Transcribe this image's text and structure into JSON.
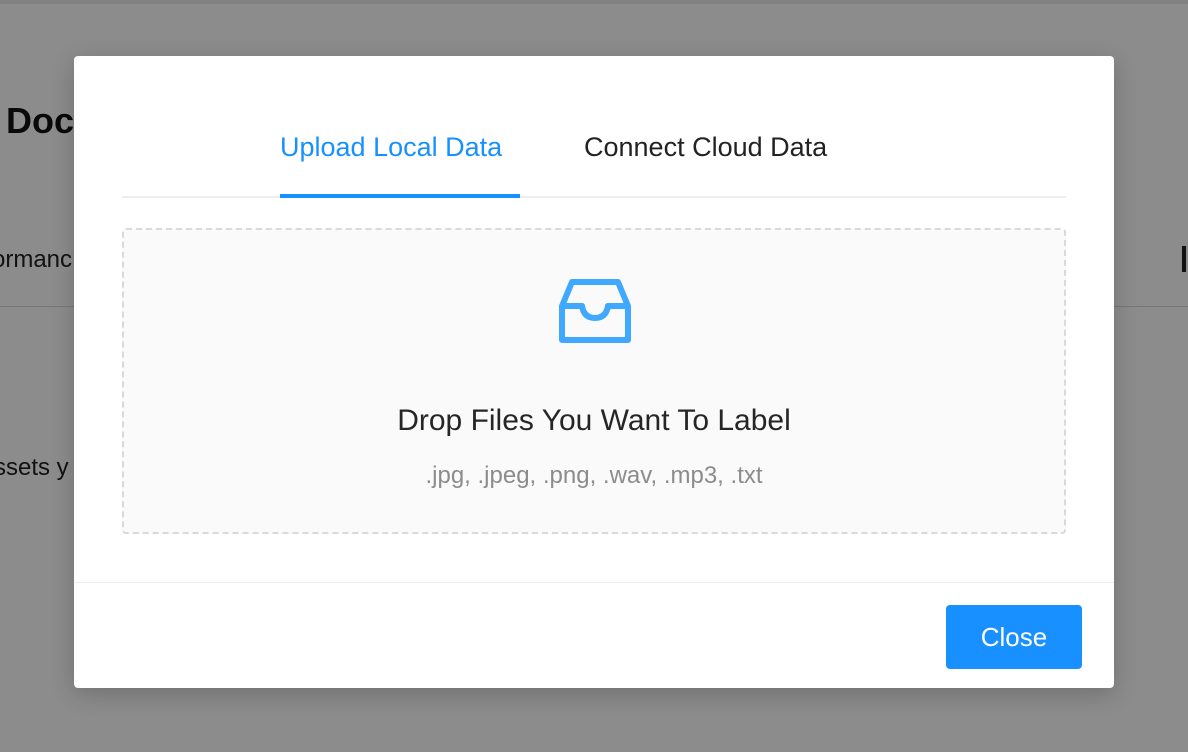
{
  "background": {
    "title": "Doc",
    "tab_left_fragment": "ormanc",
    "tab_right_fragment": "t",
    "text_fragment": "ssets y"
  },
  "modal": {
    "tabs": [
      {
        "label": "Upload Local Data",
        "active": true
      },
      {
        "label": "Connect Cloud Data",
        "active": false
      }
    ],
    "dropzone": {
      "icon": "inbox-icon",
      "title": "Drop Files You Want To Label",
      "hint": ".jpg, .jpeg, .png, .wav, .mp3, .txt"
    },
    "footer": {
      "close_label": "Close"
    }
  },
  "colors": {
    "accent": "#1890ff",
    "overlay": "rgba(0,0,0,0.45)"
  }
}
